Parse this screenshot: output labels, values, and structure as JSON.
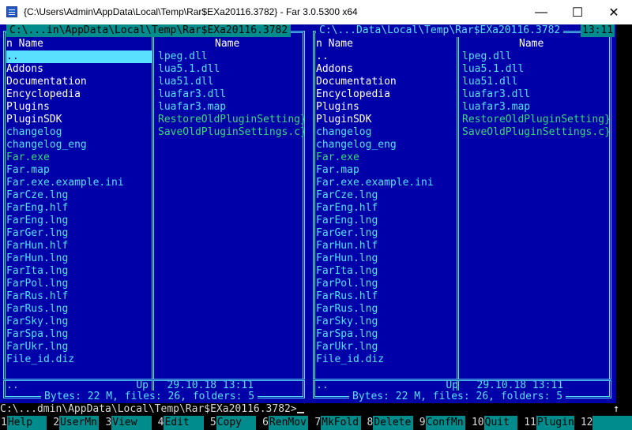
{
  "window": {
    "title": "{C:\\Users\\Admin\\AppData\\Local\\Temp\\Rar$EXa20116.3782} - Far 3.0.5300 x64",
    "minimize": "—",
    "maximize": "☐",
    "close": "✕"
  },
  "left_panel": {
    "title": " C:\\...in\\AppData\\Local\\Temp\\Rar$EXa20116.3782 ",
    "col1_header": "n          Name",
    "col2_header": "Name",
    "col1": [
      {
        "name": "..",
        "type": "sel"
      },
      {
        "name": "Addons",
        "type": "dir"
      },
      {
        "name": "Documentation",
        "type": "dir"
      },
      {
        "name": "Encyclopedia",
        "type": "dir"
      },
      {
        "name": "Plugins",
        "type": "dir"
      },
      {
        "name": "PluginSDK",
        "type": "dir"
      },
      {
        "name": "changelog",
        "type": "file"
      },
      {
        "name": "changelog_eng",
        "type": "file"
      },
      {
        "name": "Far.exe",
        "type": "exe"
      },
      {
        "name": "Far.map",
        "type": "file"
      },
      {
        "name": "Far.exe.example.ini",
        "type": "file"
      },
      {
        "name": "FarCze.lng",
        "type": "file"
      },
      {
        "name": "FarEng.hlf",
        "type": "file"
      },
      {
        "name": "FarEng.lng",
        "type": "file"
      },
      {
        "name": "FarGer.lng",
        "type": "file"
      },
      {
        "name": "FarHun.hlf",
        "type": "file"
      },
      {
        "name": "FarHun.lng",
        "type": "file"
      },
      {
        "name": "FarIta.lng",
        "type": "file"
      },
      {
        "name": "FarPol.lng",
        "type": "file"
      },
      {
        "name": "FarRus.hlf",
        "type": "file"
      },
      {
        "name": "FarRus.lng",
        "type": "file"
      },
      {
        "name": "FarSky.lng",
        "type": "file"
      },
      {
        "name": "FarSpa.lng",
        "type": "file"
      },
      {
        "name": "FarUkr.lng",
        "type": "file"
      },
      {
        "name": "File_id.diz",
        "type": "file"
      }
    ],
    "col2": [
      {
        "name": "lpeg.dll",
        "type": "file"
      },
      {
        "name": "lua5.1.dll",
        "type": "file"
      },
      {
        "name": "lua51.dll",
        "type": "file"
      },
      {
        "name": "luafar3.dll",
        "type": "file"
      },
      {
        "name": "luafar3.map",
        "type": "file"
      },
      {
        "name": "RestoreOldPluginSetting}",
        "type": "exe"
      },
      {
        "name": "SaveOldPluginSettings.c}",
        "type": "exe"
      }
    ],
    "status": "..                   Up   29.10.18 13:11",
    "bottom": " Bytes: 22 M, files: 26, folders: 5 "
  },
  "right_panel": {
    "title": " C:\\...Data\\Local\\Temp\\Rar$EXa20116.3782 ",
    "clock": "13:11",
    "col1_header": "n          Name",
    "col2_header": "Name",
    "col1": [
      {
        "name": "..",
        "type": "dir"
      },
      {
        "name": "Addons",
        "type": "dir"
      },
      {
        "name": "Documentation",
        "type": "dir"
      },
      {
        "name": "Encyclopedia",
        "type": "dir"
      },
      {
        "name": "Plugins",
        "type": "dir"
      },
      {
        "name": "PluginSDK",
        "type": "dir"
      },
      {
        "name": "changelog",
        "type": "file"
      },
      {
        "name": "changelog_eng",
        "type": "file"
      },
      {
        "name": "Far.exe",
        "type": "exe"
      },
      {
        "name": "Far.map",
        "type": "file"
      },
      {
        "name": "Far.exe.example.ini",
        "type": "file"
      },
      {
        "name": "FarCze.lng",
        "type": "file"
      },
      {
        "name": "FarEng.hlf",
        "type": "file"
      },
      {
        "name": "FarEng.lng",
        "type": "file"
      },
      {
        "name": "FarGer.lng",
        "type": "file"
      },
      {
        "name": "FarHun.hlf",
        "type": "file"
      },
      {
        "name": "FarHun.lng",
        "type": "file"
      },
      {
        "name": "FarIta.lng",
        "type": "file"
      },
      {
        "name": "FarPol.lng",
        "type": "file"
      },
      {
        "name": "FarRus.hlf",
        "type": "file"
      },
      {
        "name": "FarRus.lng",
        "type": "file"
      },
      {
        "name": "FarSky.lng",
        "type": "file"
      },
      {
        "name": "FarSpa.lng",
        "type": "file"
      },
      {
        "name": "FarUkr.lng",
        "type": "file"
      },
      {
        "name": "File_id.diz",
        "type": "file"
      }
    ],
    "col2": [
      {
        "name": "lpeg.dll",
        "type": "file"
      },
      {
        "name": "lua5.1.dll",
        "type": "file"
      },
      {
        "name": "lua51.dll",
        "type": "file"
      },
      {
        "name": "luafar3.dll",
        "type": "file"
      },
      {
        "name": "luafar3.map",
        "type": "file"
      },
      {
        "name": "RestoreOldPluginSetting}",
        "type": "exe"
      },
      {
        "name": "SaveOldPluginSettings.c}",
        "type": "exe"
      }
    ],
    "status": "..                   Up   29.10.18 13:11",
    "bottom": " Bytes: 22 M, files: 26, folders: 5 "
  },
  "command_line": "C:\\...dmin\\AppData\\Local\\Temp\\Rar$EXa20116.3782>",
  "scroll_arrow": "↑",
  "keybar": [
    {
      "num": "1",
      "label": "Help"
    },
    {
      "num": "2",
      "label": "UserMn"
    },
    {
      "num": "3",
      "label": "View"
    },
    {
      "num": "4",
      "label": "Edit"
    },
    {
      "num": "5",
      "label": "Copy"
    },
    {
      "num": "6",
      "label": "RenMov"
    },
    {
      "num": "7",
      "label": "MkFold"
    },
    {
      "num": "8",
      "label": "Delete"
    },
    {
      "num": "9",
      "label": "ConfMn"
    },
    {
      "num": "10",
      "label": "Quit"
    },
    {
      "num": "11",
      "label": "Plugin"
    },
    {
      "num": "12",
      "label": ""
    }
  ]
}
